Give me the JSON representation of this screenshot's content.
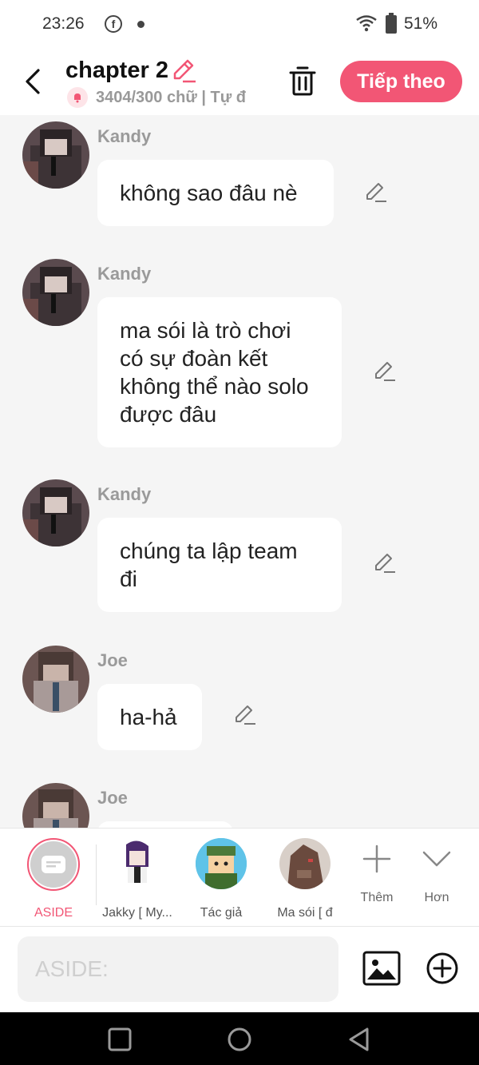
{
  "status": {
    "time": "23:26",
    "battery": "51%",
    "icons": [
      "facebook-icon",
      "dot-icon",
      "wifi-icon",
      "battery-icon"
    ]
  },
  "header": {
    "title": "chapter 2",
    "meta": "3404/300 chữ | Tự đ",
    "next_label": "Tiếp theo",
    "accent_color": "#f25675"
  },
  "messages": [
    {
      "sender": "Kandy",
      "text": "không sao đâu nè"
    },
    {
      "sender": "Kandy",
      "text": "ma sói là trò chơi có sự đoàn kết không thể nào solo được đâu"
    },
    {
      "sender": "Kandy",
      "text": "chúng ta lập team đi"
    },
    {
      "sender": "Joe",
      "text": "ha-hả"
    },
    {
      "sender": "Joe",
      "text": ""
    }
  ],
  "characters": [
    {
      "label": "ASIDE"
    },
    {
      "label": "Jakky [ My..."
    },
    {
      "label": "Tác giả"
    },
    {
      "label": "Ma sói [ đ"
    }
  ],
  "tools": {
    "more_label": "Thêm",
    "collapse_label": "Hơn"
  },
  "input": {
    "placeholder": "ASIDE:"
  }
}
